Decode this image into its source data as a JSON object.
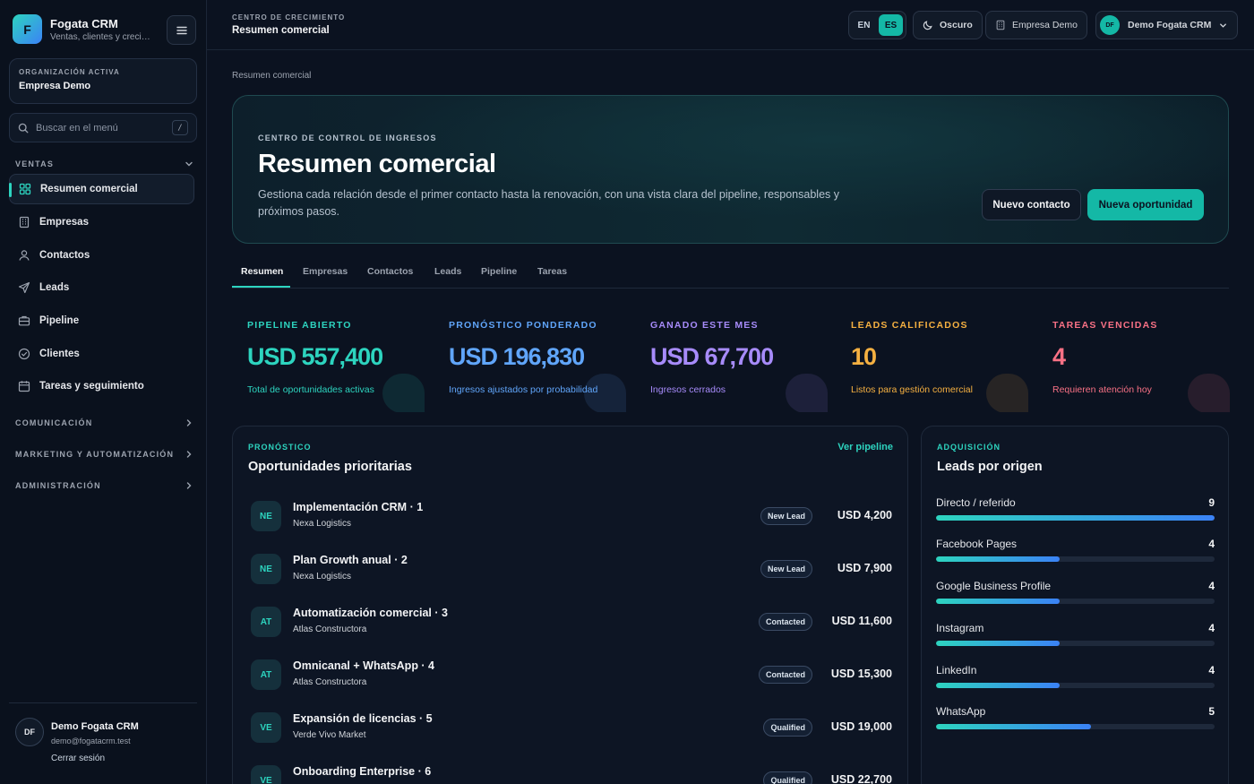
{
  "app": {
    "logo_letter": "F",
    "name": "Fogata CRM",
    "subtitle": "Ventas, clientes y crecimiento"
  },
  "org": {
    "label": "ORGANIZACIÓN ACTIVA",
    "name": "Empresa Demo"
  },
  "search": {
    "placeholder": "Buscar en el menú",
    "shortcut": "/"
  },
  "sidebar": {
    "sections": [
      {
        "label": "VENTAS",
        "expanded": true
      },
      {
        "label": "COMUNICACIÓN",
        "expanded": false
      },
      {
        "label": "MARKETING Y AUTOMATIZACIÓN",
        "expanded": false
      },
      {
        "label": "ADMINISTRACIÓN",
        "expanded": false
      }
    ],
    "items": [
      {
        "label": "Resumen comercial",
        "icon": "grid-icon",
        "active": true
      },
      {
        "label": "Empresas",
        "icon": "building-icon"
      },
      {
        "label": "Contactos",
        "icon": "user-icon"
      },
      {
        "label": "Leads",
        "icon": "send-icon"
      },
      {
        "label": "Pipeline",
        "icon": "briefcase-icon"
      },
      {
        "label": "Clientes",
        "icon": "check-circle-icon"
      },
      {
        "label": "Tareas y seguimiento",
        "icon": "calendar-icon"
      }
    ]
  },
  "user": {
    "initials": "DF",
    "name": "Demo Fogata CRM",
    "email": "demo@fogatacrm.test",
    "logout": "Cerrar sesión"
  },
  "topbar": {
    "eyebrow": "CENTRO DE CRECIMIENTO",
    "title": "Resumen comercial",
    "lang_en": "EN",
    "lang_es": "ES",
    "theme": "Oscuro",
    "company": "Empresa Demo",
    "account_initials": "DF",
    "account": "Demo Fogata CRM"
  },
  "breadcrumb": "Resumen comercial",
  "hero": {
    "eyebrow": "CENTRO DE CONTROL DE INGRESOS",
    "title": "Resumen comercial",
    "description": "Gestiona cada relación desde el primer contacto hasta la renovación, con una vista clara del pipeline, responsables y próximos pasos.",
    "secondary_button": "Nuevo contacto",
    "primary_button": "Nueva oportunidad"
  },
  "tabs": [
    "Resumen",
    "Empresas",
    "Contactos",
    "Leads",
    "Pipeline",
    "Tareas"
  ],
  "kpis": [
    {
      "label": "PIPELINE ABIERTO",
      "value": "USD 557,400",
      "sub": "Total de oportunidades activas",
      "color": "#2dd4bf"
    },
    {
      "label": "PRONÓSTICO PONDERADO",
      "value": "USD 196,830",
      "sub": "Ingresos ajustados por probabilidad",
      "color": "#60a5fa"
    },
    {
      "label": "GANADO ESTE MES",
      "value": "USD 67,700",
      "sub": "Ingresos cerrados",
      "color": "#a78bfa"
    },
    {
      "label": "LEADS CALIFICADOS",
      "value": "10",
      "sub": "Listos para gestión comercial",
      "color": "#f5b041"
    },
    {
      "label": "TAREAS VENCIDAS",
      "value": "4",
      "sub": "Requieren atención hoy",
      "color": "#f87185"
    }
  ],
  "opportunities": {
    "eyebrow": "PRONÓSTICO",
    "title": "Oportunidades prioritarias",
    "link": "Ver pipeline",
    "rows": [
      {
        "initials": "NE",
        "title": "Implementación CRM · 1",
        "company": "Nexa Logistics",
        "status": "New Lead",
        "amount": "USD 4,200"
      },
      {
        "initials": "NE",
        "title": "Plan Growth anual · 2",
        "company": "Nexa Logistics",
        "status": "New Lead",
        "amount": "USD 7,900"
      },
      {
        "initials": "AT",
        "title": "Automatización comercial · 3",
        "company": "Atlas Constructora",
        "status": "Contacted",
        "amount": "USD 11,600"
      },
      {
        "initials": "AT",
        "title": "Omnicanal + WhatsApp · 4",
        "company": "Atlas Constructora",
        "status": "Contacted",
        "amount": "USD 15,300"
      },
      {
        "initials": "VE",
        "title": "Expansión de licencias · 5",
        "company": "Verde Vivo Market",
        "status": "Qualified",
        "amount": "USD 19,000"
      },
      {
        "initials": "VE",
        "title": "Onboarding Enterprise · 6",
        "company": "",
        "status": "Qualified",
        "amount": "USD 22,700"
      }
    ]
  },
  "sources": {
    "eyebrow": "ADQUISICIÓN",
    "title": "Leads por origen",
    "max": 9,
    "rows": [
      {
        "name": "Directo / referido",
        "count": 9
      },
      {
        "name": "Facebook Pages",
        "count": 4
      },
      {
        "name": "Google Business Profile",
        "count": 4
      },
      {
        "name": "Instagram",
        "count": 4
      },
      {
        "name": "LinkedIn",
        "count": 4
      },
      {
        "name": "WhatsApp",
        "count": 5
      }
    ]
  }
}
